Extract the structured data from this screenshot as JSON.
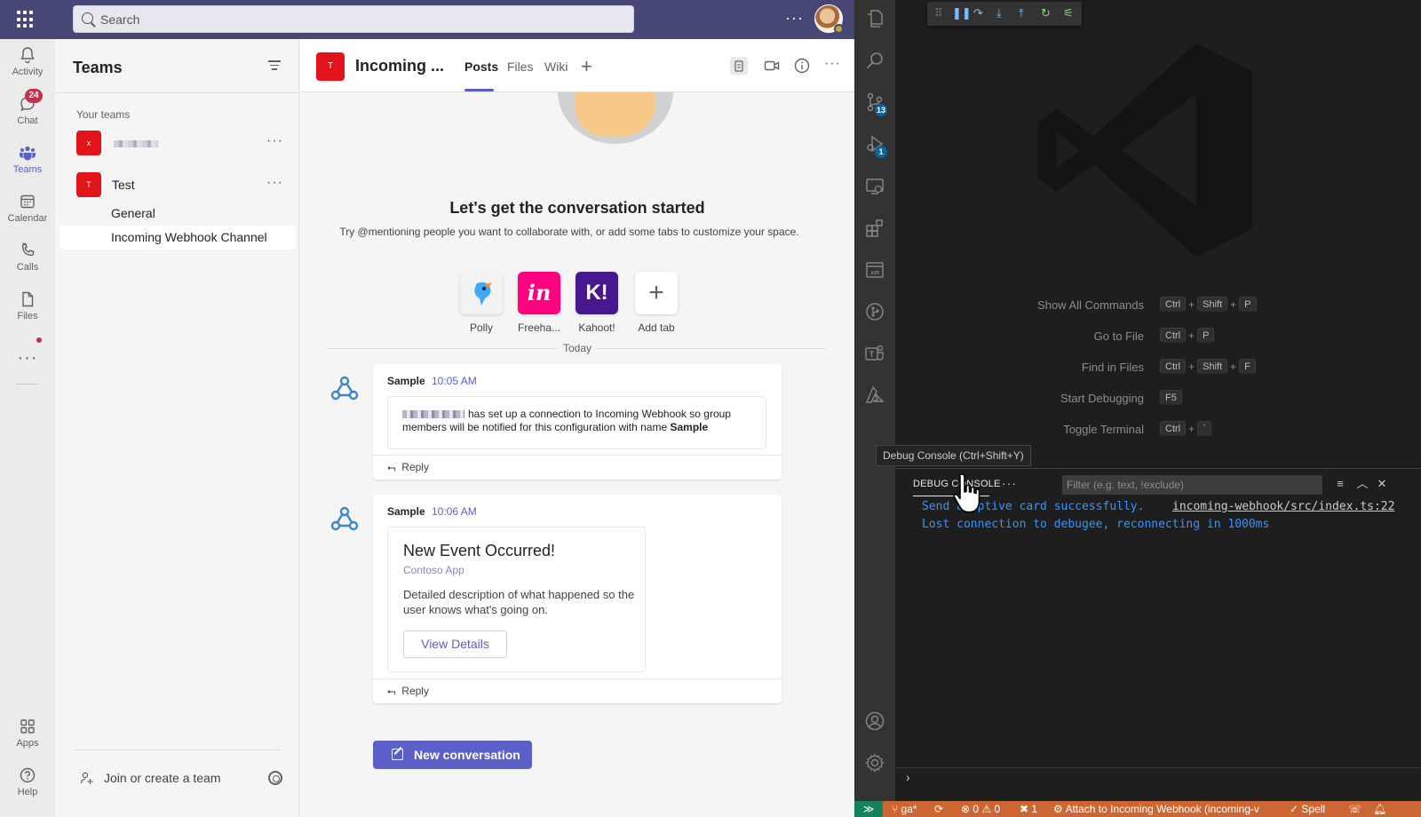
{
  "teams": {
    "search_placeholder": "Search",
    "rail": [
      {
        "label": "Activity"
      },
      {
        "label": "Chat",
        "badge": "24"
      },
      {
        "label": "Teams"
      },
      {
        "label": "Calendar"
      },
      {
        "label": "Calls"
      },
      {
        "label": "Files"
      },
      {
        "label": "Apps"
      },
      {
        "label": "Help"
      }
    ],
    "list": {
      "title": "Teams",
      "your_teams": "Your teams",
      "team1_initial": "x",
      "team2_initial": "T",
      "team2_name": "Test",
      "channels": [
        "General",
        "Incoming Webhook Channel"
      ],
      "join": "Join or create a team"
    },
    "header": {
      "channel_initial": "T",
      "title": "Incoming ...",
      "tabs": [
        "Posts",
        "Files",
        "Wiki"
      ]
    },
    "body": {
      "heading": "Let's get the conversation started",
      "subheading": "Try @mentioning people you want to collaborate with, or add some tabs to customize your space.",
      "apps": [
        {
          "label": "Polly",
          "glyph": "",
          "color": "#f2f2f2"
        },
        {
          "label": "Freeha...",
          "glyph": "in",
          "color": "#ff0080"
        },
        {
          "label": "Kahoot!",
          "glyph": "K!",
          "color": "#46178f"
        },
        {
          "label": "Add tab",
          "glyph": "+",
          "color": "#ffffff"
        }
      ],
      "today": "Today",
      "post1": {
        "author": "Sample",
        "time": "10:05 AM",
        "text_a": "has set up a connection to Incoming Webhook so group members will be notified for this configuration with name",
        "text_b": "Sample",
        "reply": "Reply"
      },
      "post2": {
        "author": "Sample",
        "time": "10:06 AM",
        "card_title": "New Event Occurred!",
        "card_sub": "Contoso App",
        "card_desc": "Detailed description of what happened so the user knows what's going on.",
        "card_button": "View Details",
        "reply": "Reply"
      },
      "new_conversation": "New conversation"
    }
  },
  "vscode": {
    "commands": [
      {
        "label": "Show All Commands",
        "keys": [
          "Ctrl",
          "Shift",
          "P"
        ]
      },
      {
        "label": "Go to File",
        "keys": [
          "Ctrl",
          "P"
        ]
      },
      {
        "label": "Find in Files",
        "keys": [
          "Ctrl",
          "Shift",
          "F"
        ]
      },
      {
        "label": "Start Debugging",
        "keys": [
          "F5"
        ]
      },
      {
        "label": "Toggle Terminal",
        "keys": [
          "Ctrl",
          "`"
        ]
      }
    ],
    "badges": {
      "scm": "13",
      "debug": "1"
    },
    "tooltip": "Debug Console (Ctrl+Shift+Y)",
    "panel": {
      "tab": "DEBUG CONSOLE",
      "filter_placeholder": "Filter (e.g. text, !exclude)",
      "lines": [
        {
          "text": "Send adaptive card successfully."
        },
        {
          "text": "Lost connection to debugee, reconnecting in 1000ms"
        }
      ],
      "source": "incoming-webhook/src/index.ts:22"
    },
    "status": {
      "branch": "ga*",
      "errors": "0",
      "warnings": "0",
      "ports": "1",
      "launch": "Attach to Incoming Webhook (incoming-v",
      "spell": "Spell"
    },
    "colors": {
      "status_bar": "#cc6633",
      "remote": "#16825d",
      "console_text": "#3794ff"
    }
  }
}
